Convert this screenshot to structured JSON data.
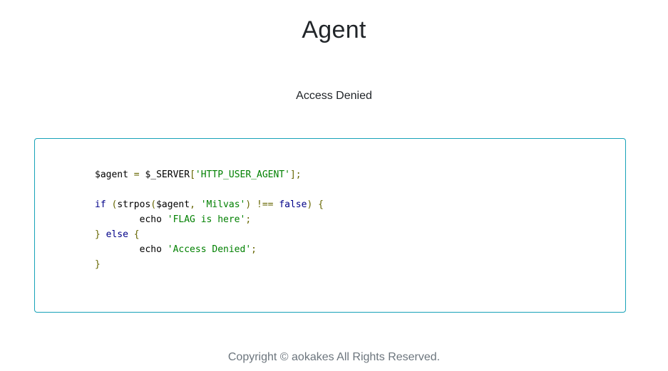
{
  "page": {
    "title": "Agent",
    "status_message": "Access Denied",
    "footer": "Copyright © aokakes All Rights Reserved."
  },
  "code": {
    "language": "php",
    "lines": [
      [
        {
          "t": "plain",
          "v": "$agent "
        },
        {
          "t": "op",
          "v": "="
        },
        {
          "t": "plain",
          "v": " $_SERVER"
        },
        {
          "t": "op",
          "v": "["
        },
        {
          "t": "str",
          "v": "'HTTP_USER_AGENT'"
        },
        {
          "t": "op",
          "v": "];"
        }
      ],
      [],
      [
        {
          "t": "kw",
          "v": "if"
        },
        {
          "t": "plain",
          "v": " "
        },
        {
          "t": "op",
          "v": "("
        },
        {
          "t": "plain",
          "v": "strpos"
        },
        {
          "t": "op",
          "v": "("
        },
        {
          "t": "plain",
          "v": "$agent"
        },
        {
          "t": "op",
          "v": ","
        },
        {
          "t": "plain",
          "v": " "
        },
        {
          "t": "str",
          "v": "'Milvas'"
        },
        {
          "t": "op",
          "v": ")"
        },
        {
          "t": "plain",
          "v": " "
        },
        {
          "t": "op",
          "v": "!=="
        },
        {
          "t": "plain",
          "v": " "
        },
        {
          "t": "kw",
          "v": "false"
        },
        {
          "t": "op",
          "v": ")"
        },
        {
          "t": "plain",
          "v": " "
        },
        {
          "t": "op",
          "v": "{"
        }
      ],
      [
        {
          "t": "plain",
          "v": "        echo "
        },
        {
          "t": "str",
          "v": "'FLAG is here'"
        },
        {
          "t": "op",
          "v": ";"
        }
      ],
      [
        {
          "t": "op",
          "v": "}"
        },
        {
          "t": "plain",
          "v": " "
        },
        {
          "t": "kw",
          "v": "else"
        },
        {
          "t": "plain",
          "v": " "
        },
        {
          "t": "op",
          "v": "{"
        }
      ],
      [
        {
          "t": "plain",
          "v": "        echo "
        },
        {
          "t": "str",
          "v": "'Access Denied'"
        },
        {
          "t": "op",
          "v": ";"
        }
      ],
      [
        {
          "t": "op",
          "v": "}"
        }
      ]
    ]
  },
  "colors": {
    "border_accent": "#17a2b8",
    "string": "#008000",
    "keyword": "#000088",
    "punctuation": "#666600",
    "footer_text": "#6c757d"
  }
}
